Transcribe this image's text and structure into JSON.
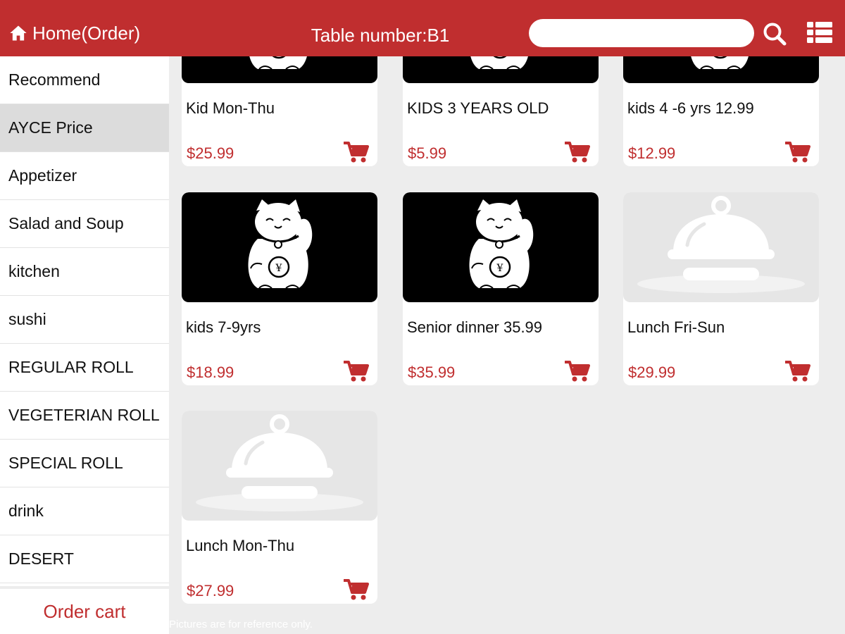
{
  "header": {
    "home_label": "Home(Order)",
    "table_number": "Table number:B1",
    "search_value": "",
    "search_placeholder": ""
  },
  "colors": {
    "brand_red": "#c02e2f",
    "background": "#ededed",
    "active_category_bg": "#dcdcdc"
  },
  "icons": {
    "home": "home-icon",
    "search": "search-icon",
    "menu": "list-menu-icon",
    "cart": "shopping-cart-icon",
    "lucky_cat": "lucky-cat-icon",
    "placeholder": "food-cloche-icon"
  },
  "sidebar": {
    "categories": [
      {
        "label": "Recommend",
        "active": false
      },
      {
        "label": "AYCE Price",
        "active": true
      },
      {
        "label": "Appetizer",
        "active": false
      },
      {
        "label": "Salad and Soup",
        "active": false
      },
      {
        "label": "kitchen",
        "active": false
      },
      {
        "label": "sushi",
        "active": false
      },
      {
        "label": "REGULAR ROLL",
        "active": false
      },
      {
        "label": "VEGETERIAN ROLL",
        "active": false
      },
      {
        "label": "SPECIAL ROLL",
        "active": false
      },
      {
        "label": "drink",
        "active": false
      },
      {
        "label": "DESERT",
        "active": false
      }
    ],
    "order_cart_label": "Order cart"
  },
  "products": [
    {
      "name": "Kid Mon-Thu",
      "price": "$25.99",
      "image": "lucky-cat"
    },
    {
      "name": "KIDS 3 YEARS OLD",
      "price": "$5.99",
      "image": "lucky-cat"
    },
    {
      "name": "kids 4 -6 yrs 12.99",
      "price": "$12.99",
      "image": "lucky-cat"
    },
    {
      "name": "kids 7-9yrs",
      "price": "$18.99",
      "image": "lucky-cat"
    },
    {
      "name": "Senior dinner 35.99",
      "price": "$35.99",
      "image": "lucky-cat"
    },
    {
      "name": "Lunch Fri-Sun",
      "price": "$29.99",
      "image": "placeholder"
    },
    {
      "name": "Lunch Mon-Thu",
      "price": "$27.99",
      "image": "placeholder"
    }
  ],
  "footnote": "Pictures are for reference only."
}
